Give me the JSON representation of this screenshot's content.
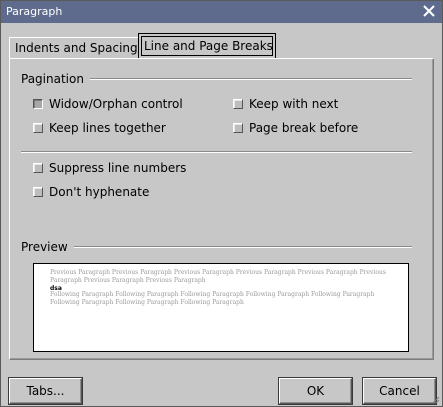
{
  "window": {
    "title": "Paragraph",
    "close_icon": "close-icon"
  },
  "tabs": [
    {
      "label": "Indents and Spacing",
      "active": false
    },
    {
      "label": "Line and Page Breaks",
      "active": true
    }
  ],
  "pagination": {
    "heading": "Pagination",
    "options": [
      {
        "label": "Widow/Orphan control",
        "checked": true
      },
      {
        "label": "Keep with next",
        "checked": false
      },
      {
        "label": "Keep lines together",
        "checked": false
      },
      {
        "label": "Page break before",
        "checked": false
      }
    ]
  },
  "other_options": [
    {
      "label": "Suppress line numbers",
      "checked": false
    },
    {
      "label": "Don't hyphenate",
      "checked": false
    }
  ],
  "preview": {
    "heading": "Preview",
    "previous_text": "Previous Paragraph Previous Paragraph Previous Paragraph Previous Paragraph Previous Paragraph Previous Paragraph Previous Paragraph Previous Paragraph",
    "current_text": "dsa",
    "following_text": "Following Paragraph Following Paragraph Following Paragraph Following Paragraph Following Paragraph Following Paragraph Following Paragraph Following Paragraph"
  },
  "buttons": {
    "tabs": "Tabs...",
    "ok": "OK",
    "cancel": "Cancel"
  },
  "colors": {
    "titlebar": "#5e6b8d",
    "dialog_background": "#c7c7c7",
    "preview_background": "#ffffff"
  }
}
